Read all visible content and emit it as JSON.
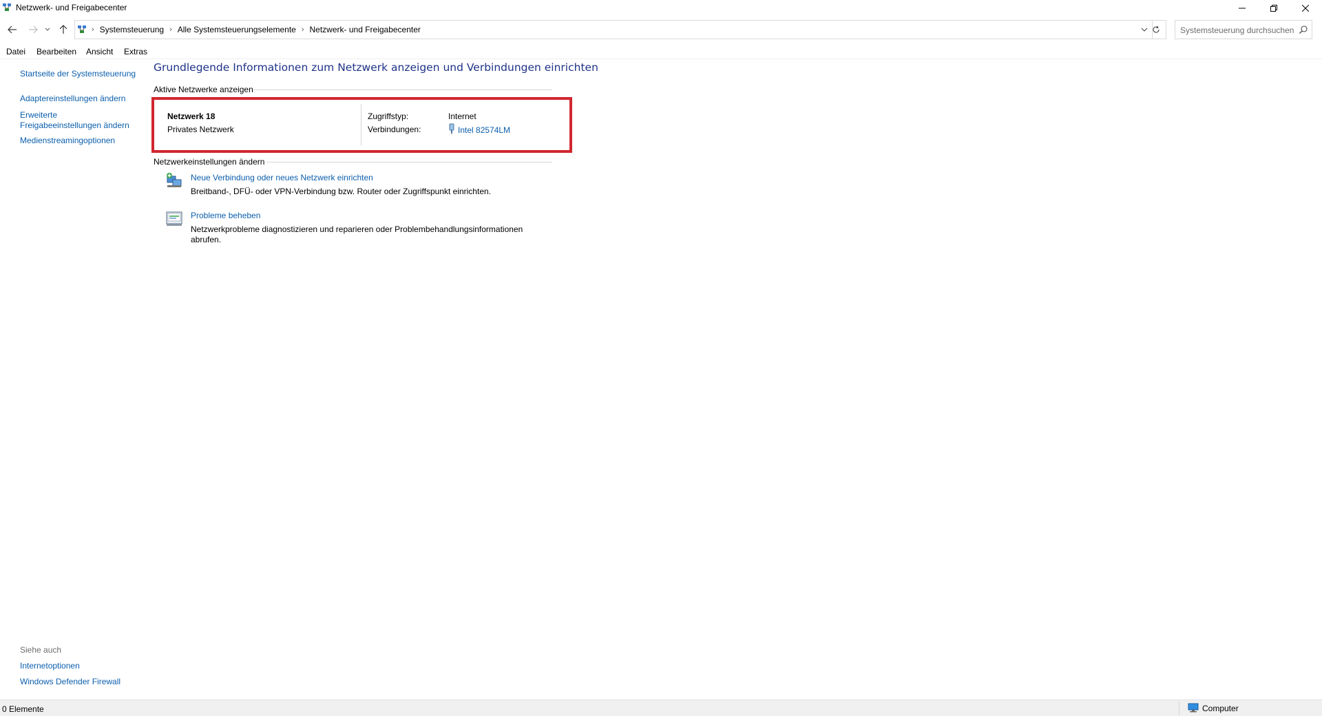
{
  "window": {
    "title": "Netzwerk- und Freigabecenter"
  },
  "address": {
    "breadcrumbs": [
      "Systemsteuerung",
      "Alle Systemsteuerungselemente",
      "Netzwerk- und Freigabecenter"
    ],
    "search_placeholder": "Systemsteuerung durchsuchen"
  },
  "menu": {
    "items": [
      "Datei",
      "Bearbeiten",
      "Ansicht",
      "Extras"
    ]
  },
  "sidebar": {
    "links": [
      "Startseite der Systemsteuerung",
      "Adaptereinstellungen ändern",
      "Erweiterte Freigabeeinstellungen ändern",
      "Medienstreamingoptionen"
    ],
    "see_also_label": "Siehe auch",
    "see_also_links": [
      "Internetoptionen",
      "Windows Defender Firewall"
    ]
  },
  "main": {
    "title": "Grundlegende Informationen zum Netzwerk anzeigen und Verbindungen einrichten",
    "active_networks_heading": "Aktive Netzwerke anzeigen",
    "network": {
      "name": "Netzwerk 18",
      "type": "Privates Netzwerk",
      "access_label": "Zugriffstyp:",
      "access_value": "Internet",
      "connections_label": "Verbindungen:",
      "connection_name": "Intel 82574LM"
    },
    "change_settings_heading": "Netzwerkeinstellungen ändern",
    "tasks": [
      {
        "link": "Neue Verbindung oder neues Netzwerk einrichten",
        "description": "Breitband-, DFÜ- oder VPN-Verbindung bzw. Router oder Zugriffspunkt einrichten."
      },
      {
        "link": "Probleme beheben",
        "description": "Netzwerkprobleme diagnostizieren und reparieren oder Problembehandlungsinformationen abrufen."
      }
    ]
  },
  "status": {
    "item_count": "0 Elemente",
    "location": "Computer"
  },
  "colors": {
    "link": "#0b5eac",
    "title": "#1e3287",
    "highlight_border": "#d1262f"
  }
}
